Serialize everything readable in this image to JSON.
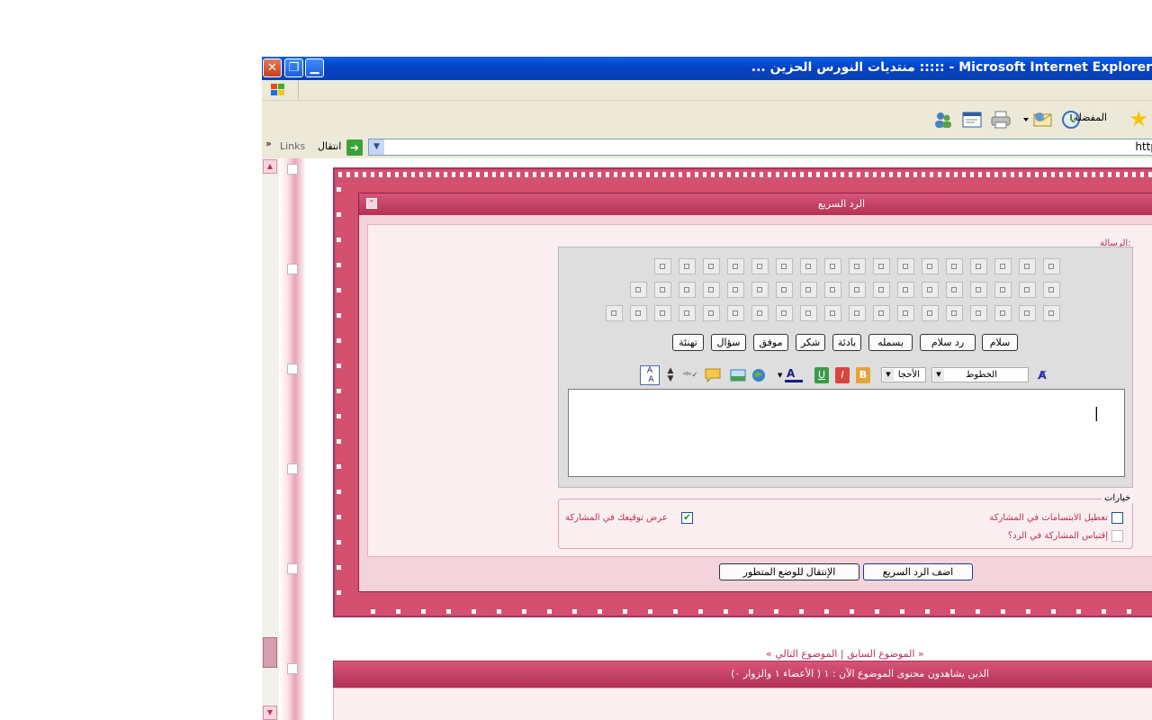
{
  "window": {
    "title": "... منتديات النورس الحزين ::::: - Microsoft Internet Explorer",
    "close_glyph": "✕",
    "restore_glyph": "❐",
    "minimize_glyph": "▁"
  },
  "toolbar": {
    "favorites_label": "المفضلة"
  },
  "address_bar": {
    "url": "http",
    "go_label": "انتقال",
    "links_label": "Links",
    "links_chevron": "»"
  },
  "quick_reply": {
    "title": "الرد السريع",
    "message_label": "الرسالة:",
    "quick_buttons": [
      "سلام",
      "رد سلام",
      "بسمله",
      "بادئة",
      "شكر",
      "موفق",
      "سؤال",
      "تهنئة"
    ],
    "font_select": "الخطوط",
    "size_select": "الأحجا",
    "options_legend": "خيارات",
    "options": [
      {
        "label": "تعطيل الابتسامات في المشاركة",
        "checked": false
      },
      {
        "label": "إقتباس المشاركة في الرد؟",
        "checked": false
      },
      {
        "label": "عرض توقيعك في المشاركة",
        "checked": true
      }
    ],
    "submit_label": "اضف الرد السريع",
    "advanced_label": "الإنتقال للوضع المتطور"
  },
  "topic_nav": "« الموضوع السابق | الموضوع التالي »",
  "viewers_text": "الذين يشاهدون محتوى الموضوع الآن : ١ ( الأعضاء ١ والزوار ٠)",
  "colors": {
    "accent": "#b53256",
    "panel_bg": "#faeef1"
  }
}
